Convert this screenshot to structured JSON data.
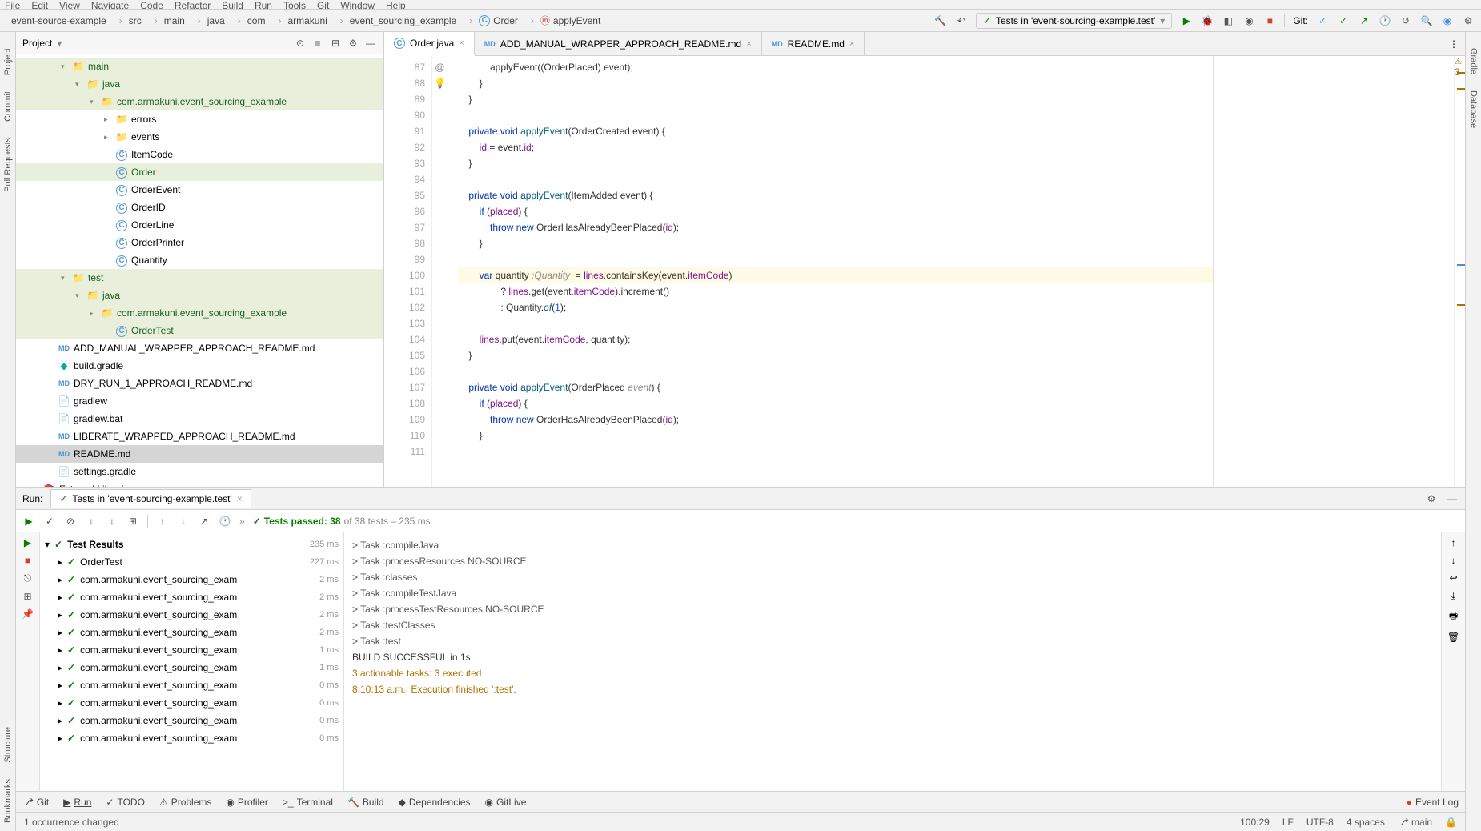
{
  "menu": [
    "File",
    "Edit",
    "View",
    "Navigate",
    "Code",
    "Refactor",
    "Build",
    "Run",
    "Tools",
    "Git",
    "Window",
    "Help"
  ],
  "breadcrumbs": [
    "event-source-example",
    "src",
    "main",
    "java",
    "com",
    "armakuni",
    "event_sourcing_example",
    "Order",
    "applyEvent"
  ],
  "runConfig": "Tests in 'event-sourcing-example.test'",
  "gitLabel": "Git:",
  "project": {
    "title": "Project",
    "tree": [
      {
        "d": 2,
        "a": "▾",
        "i": "folder",
        "t": "main",
        "mod": true
      },
      {
        "d": 3,
        "a": "▾",
        "i": "folder",
        "t": "java",
        "mod": true
      },
      {
        "d": 4,
        "a": "▾",
        "i": "folder",
        "t": "com.armakuni.event_sourcing_example",
        "mod": true
      },
      {
        "d": 5,
        "a": "▸",
        "i": "folder",
        "t": "errors"
      },
      {
        "d": 5,
        "a": "▸",
        "i": "folder",
        "t": "events"
      },
      {
        "d": 5,
        "a": "",
        "i": "class",
        "t": "ItemCode"
      },
      {
        "d": 5,
        "a": "",
        "i": "class",
        "t": "Order",
        "mod": true
      },
      {
        "d": 5,
        "a": "",
        "i": "class",
        "t": "OrderEvent"
      },
      {
        "d": 5,
        "a": "",
        "i": "class",
        "t": "OrderID"
      },
      {
        "d": 5,
        "a": "",
        "i": "class",
        "t": "OrderLine"
      },
      {
        "d": 5,
        "a": "",
        "i": "class",
        "t": "OrderPrinter"
      },
      {
        "d": 5,
        "a": "",
        "i": "class",
        "t": "Quantity"
      },
      {
        "d": 2,
        "a": "▾",
        "i": "folder",
        "t": "test",
        "mod": true
      },
      {
        "d": 3,
        "a": "▾",
        "i": "folder",
        "t": "java",
        "mod": true
      },
      {
        "d": 4,
        "a": "▸",
        "i": "folder",
        "t": "com.armakuni.event_sourcing_example",
        "mod": true
      },
      {
        "d": 5,
        "a": "",
        "i": "class",
        "t": "OrderTest",
        "mod": true
      },
      {
        "d": 1,
        "a": "",
        "i": "md",
        "t": "ADD_MANUAL_WRAPPER_APPROACH_README.md"
      },
      {
        "d": 1,
        "a": "",
        "i": "gradle",
        "t": "build.gradle"
      },
      {
        "d": 1,
        "a": "",
        "i": "md",
        "t": "DRY_RUN_1_APPROACH_README.md"
      },
      {
        "d": 1,
        "a": "",
        "i": "file",
        "t": "gradlew"
      },
      {
        "d": 1,
        "a": "",
        "i": "file",
        "t": "gradlew.bat"
      },
      {
        "d": 1,
        "a": "",
        "i": "md",
        "t": "LIBERATE_WRAPPED_APPROACH_README.md"
      },
      {
        "d": 1,
        "a": "",
        "i": "md",
        "t": "README.md",
        "sel": true
      },
      {
        "d": 1,
        "a": "",
        "i": "file",
        "t": "settings.gradle"
      },
      {
        "d": 0,
        "a": "▸",
        "i": "lib",
        "t": "External Libraries"
      }
    ]
  },
  "tabs": [
    {
      "icon": "class",
      "label": "Order.java",
      "active": true
    },
    {
      "icon": "md",
      "label": "ADD_MANUAL_WRAPPER_APPROACH_README.md"
    },
    {
      "icon": "md",
      "label": "README.md"
    }
  ],
  "warnings": "3",
  "code": {
    "startLine": 87,
    "lines": [
      {
        "n": 87,
        "html": "            applyEvent((OrderPlaced) event);"
      },
      {
        "n": 88,
        "html": "        }"
      },
      {
        "n": 89,
        "html": "    }"
      },
      {
        "n": 90,
        "html": ""
      },
      {
        "n": 91,
        "mark": "@",
        "html": "    <span class='kw'>private void</span> <span class='mth'>applyEvent</span>(OrderCreated event) {"
      },
      {
        "n": 92,
        "html": "        <span class='fld'>id</span> = event.<span class='fld'>id</span>;"
      },
      {
        "n": 93,
        "html": "    }"
      },
      {
        "n": 94,
        "html": ""
      },
      {
        "n": 95,
        "html": "    <span class='kw'>private void</span> <span class='mth'>applyEvent</span>(ItemAdded event) {"
      },
      {
        "n": 96,
        "html": "        <span class='kw'>if</span> (<span class='fld'>placed</span>) {"
      },
      {
        "n": 97,
        "html": "            <span class='kw'>throw new</span> OrderHasAlreadyBeenPlaced(<span class='fld'>id</span>);"
      },
      {
        "n": 98,
        "html": "        }"
      },
      {
        "n": 99,
        "html": ""
      },
      {
        "n": 100,
        "hl": true,
        "bulb": true,
        "html": "        <span class='kw'>var</span> quantity <span class='cmt'>:Quantity</span>  = <span class='fld'>lines</span>.containsKey(event.<span class='fld'>itemCode</span>)"
      },
      {
        "n": 101,
        "html": "                ? <span class='fld'>lines</span>.get(event.<span class='fld'>itemCode</span>).increment()"
      },
      {
        "n": 102,
        "html": "                : Quantity.<span class='mth'><i>of</i></span>(<span class='num'>1</span>);"
      },
      {
        "n": 103,
        "html": ""
      },
      {
        "n": 104,
        "html": "        <span class='fld'>lines</span>.put(event.<span class='fld'>itemCode</span>, quantity);"
      },
      {
        "n": 105,
        "html": "    }"
      },
      {
        "n": 106,
        "html": ""
      },
      {
        "n": 107,
        "html": "    <span class='kw'>private void</span> <span class='mth'>applyEvent</span>(OrderPlaced <span class='cmt'>event</span>) {"
      },
      {
        "n": 108,
        "html": "        <span class='kw'>if</span> (<span class='fld'>placed</span>) {"
      },
      {
        "n": 109,
        "html": "            <span class='kw'>throw new</span> OrderHasAlreadyBeenPlaced(<span class='fld'>id</span>);"
      },
      {
        "n": 110,
        "html": "        }"
      },
      {
        "n": 111,
        "html": ""
      }
    ]
  },
  "run": {
    "label": "Run:",
    "tab": "Tests in 'event-sourcing-example.test'",
    "passText": "Tests passed: 38",
    "passSuffix": " of 38 tests – 235 ms",
    "results": {
      "root": "Test Results",
      "rootTime": "235 ms",
      "items": [
        {
          "t": "OrderTest",
          "time": "227 ms",
          "arrow": "▸"
        },
        {
          "t": "com.armakuni.event_sourcing_exam",
          "time": "2 ms",
          "arrow": "▸"
        },
        {
          "t": "com.armakuni.event_sourcing_exam",
          "time": "2 ms",
          "arrow": "▸"
        },
        {
          "t": "com.armakuni.event_sourcing_exam",
          "time": "2 ms",
          "arrow": "▸"
        },
        {
          "t": "com.armakuni.event_sourcing_exam",
          "time": "2 ms",
          "arrow": "▸"
        },
        {
          "t": "com.armakuni.event_sourcing_exam",
          "time": "1 ms",
          "arrow": "▸"
        },
        {
          "t": "com.armakuni.event_sourcing_exam",
          "time": "1 ms",
          "arrow": "▸"
        },
        {
          "t": "com.armakuni.event_sourcing_exam",
          "time": "0 ms",
          "arrow": "▸"
        },
        {
          "t": "com.armakuni.event_sourcing_exam",
          "time": "0 ms",
          "arrow": "▸"
        },
        {
          "t": "com.armakuni.event_sourcing_exam",
          "time": "0 ms",
          "arrow": "▸"
        },
        {
          "t": "com.armakuni.event_sourcing_exam",
          "time": "0 ms",
          "arrow": "▸"
        }
      ]
    },
    "console": [
      "> Task :compileJava",
      "> Task :processResources NO-SOURCE",
      "> Task :classes",
      "> Task :compileTestJava",
      "> Task :processTestResources NO-SOURCE",
      "> Task :testClasses",
      "> Task :test",
      "BUILD SUCCESSFUL in 1s",
      "3 actionable tasks: 3 executed",
      "8:10:13 a.m.: Execution finished ':test'."
    ]
  },
  "bottomTools": [
    "Git",
    "Run",
    "TODO",
    "Problems",
    "Profiler",
    "Terminal",
    "Build",
    "Dependencies",
    "GitLive"
  ],
  "eventLog": "Event Log",
  "status": {
    "left": "1 occurrence changed",
    "pos": "100:29",
    "sep": "LF",
    "enc": "UTF-8",
    "indent": "4 spaces",
    "branch": "main"
  }
}
